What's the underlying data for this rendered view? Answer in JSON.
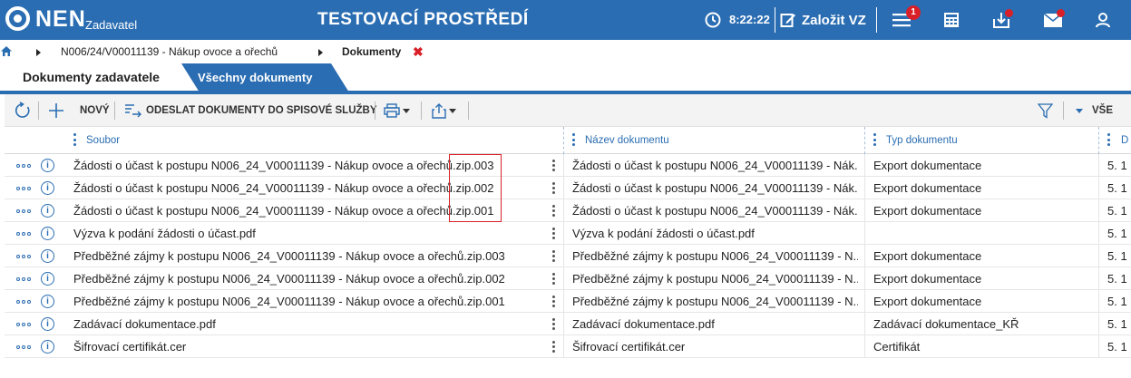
{
  "header": {
    "logo_text": "NEN",
    "logo_sub": "Zadavatel",
    "env_title": "TESTOVACÍ PROSTŘEDÍ",
    "time": "8:22:22",
    "create_label": "Založit VZ",
    "notifications_count": "1",
    "accent_color": "#2a6db2",
    "alert_color": "#d92028"
  },
  "breadcrumb": {
    "items": [
      {
        "label": "N006/24/V00011139 - Nákup ovoce a ořechů"
      },
      {
        "label": "Dokumenty"
      }
    ]
  },
  "tabs": [
    {
      "label": "Dokumenty zadavatele",
      "active": true
    },
    {
      "label": "Všechny dokumenty",
      "active": false
    }
  ],
  "toolbar": {
    "new_label": "NOVÝ",
    "send_label": "ODESLAT DOKUMENTY DO SPISOVÉ SLUŽBY",
    "filter_all_label": "VŠE"
  },
  "grid": {
    "columns": [
      "Soubor",
      "Název dokumentu",
      "Typ dokumentu",
      "D"
    ],
    "rows": [
      {
        "file": "Žádosti o účast k postupu N006_24_V00011139 - Nákup ovoce a ořechů.zip.003",
        "name": "Žádosti o účast k postupu N006_24_V00011139 - Nák...",
        "type": "Export dokumentace",
        "date": "5. 1"
      },
      {
        "file": "Žádosti o účast k postupu N006_24_V00011139 - Nákup ovoce a ořechů.zip.002",
        "name": "Žádosti o účast k postupu N006_24_V00011139 - Nák...",
        "type": "Export dokumentace",
        "date": "5. 1"
      },
      {
        "file": "Žádosti o účast k postupu N006_24_V00011139 - Nákup ovoce a ořechů.zip.001",
        "name": "Žádosti o účast k postupu N006_24_V00011139 - Nák...",
        "type": "Export dokumentace",
        "date": "5. 1"
      },
      {
        "file": "Výzva k podání žádosti o účast.pdf",
        "name": "Výzva k podání žádosti o účast.pdf",
        "type": "",
        "date": "5. 1"
      },
      {
        "file": "Předběžné zájmy k postupu N006_24_V00011139 - Nákup ovoce a ořechů.zip.003",
        "name": "Předběžné zájmy k postupu N006_24_V00011139 - N...",
        "type": "Export dokumentace",
        "date": "5. 1"
      },
      {
        "file": "Předběžné zájmy k postupu N006_24_V00011139 - Nákup ovoce a ořechů.zip.002",
        "name": "Předběžné zájmy k postupu N006_24_V00011139 - N...",
        "type": "Export dokumentace",
        "date": "5. 1"
      },
      {
        "file": "Předběžné zájmy k postupu N006_24_V00011139 - Nákup ovoce a ořechů.zip.001",
        "name": "Předběžné zájmy k postupu N006_24_V00011139 - N...",
        "type": "Export dokumentace",
        "date": "5. 1"
      },
      {
        "file": "Zadávací dokumentace.pdf",
        "name": "Zadávací dokumentace.pdf",
        "type": "Zadávací dokumentace_KŘ",
        "date": "5. 1"
      },
      {
        "file": "Šifrovací certifikát.cer",
        "name": "Šifrovací certifikát.cer",
        "type": "Certifikát",
        "date": "5. 1"
      }
    ]
  }
}
